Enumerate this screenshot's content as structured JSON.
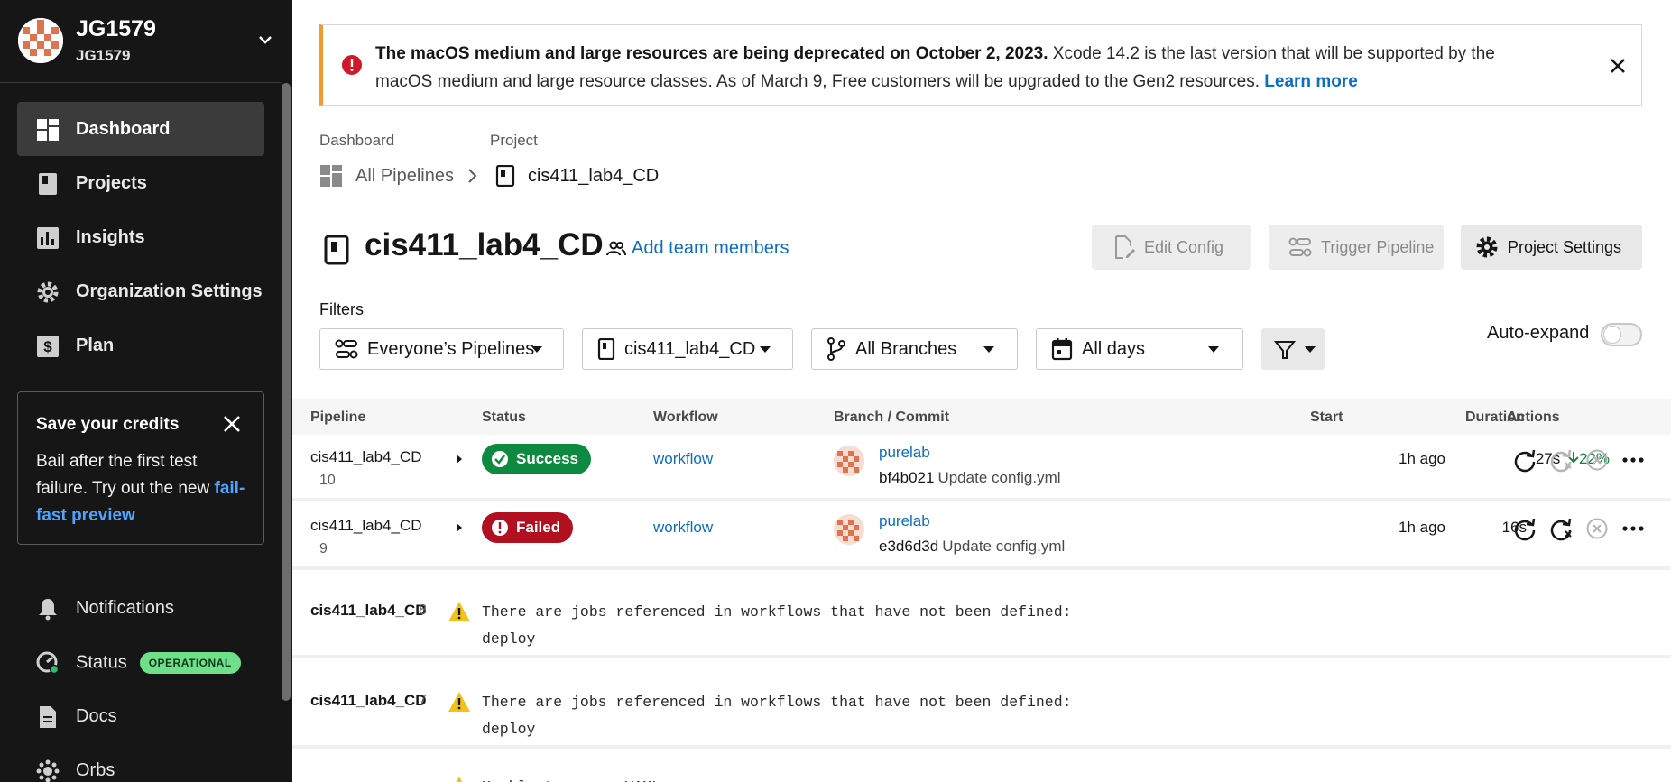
{
  "org": {
    "name": "JG1579",
    "sub": "JG1579"
  },
  "nav": [
    {
      "label": "Dashboard",
      "icon": "dashboard-icon",
      "active": true
    },
    {
      "label": "Projects",
      "icon": "projects-icon"
    },
    {
      "label": "Insights",
      "icon": "insights-icon"
    },
    {
      "label": "Organization Settings",
      "icon": "gear-icon"
    },
    {
      "label": "Plan",
      "icon": "plan-dollar-icon"
    }
  ],
  "credits": {
    "title": "Save your credits",
    "body": "Bail after the first test failure. Try out the new",
    "link": "fail-fast preview"
  },
  "bottom_nav": [
    {
      "label": "Notifications",
      "icon": "bell-icon"
    },
    {
      "label": "Status",
      "icon": "status-icon",
      "badge": "OPERATIONAL"
    },
    {
      "label": "Docs",
      "icon": "docs-icon"
    },
    {
      "label": "Orbs",
      "icon": "orbs-icon"
    }
  ],
  "banner": {
    "bold": "The macOS medium and large resources are being deprecated on October 2, 2023.",
    "text": " Xcode 14.2 is the last version that will be supported by the macOS medium and large resource classes. As of March 9, Free customers will be upgraded to the Gen2 resources. ",
    "link": "Learn more"
  },
  "breadcrumb": {
    "dashboard_label": "Dashboard",
    "project_label": "Project",
    "all_pipelines": "All Pipelines",
    "project": "cis411_lab4_CD"
  },
  "header": {
    "title": "cis411_lab4_CD",
    "add_team": "Add team members",
    "edit_config": "Edit Config",
    "trigger": "Trigger Pipeline",
    "settings": "Project Settings"
  },
  "filters": {
    "label": "Filters",
    "pipelines": "Everyone’s Pipelines",
    "project": "cis411_lab4_CD",
    "branches": "All Branches",
    "days": "All days",
    "auto_expand": "Auto-expand"
  },
  "table": {
    "headers": [
      "Pipeline",
      "Status",
      "Workflow",
      "Branch / Commit",
      "Start",
      "Duration",
      "Actions"
    ],
    "rows": [
      {
        "pipeline": "cis411_lab4_CD",
        "num": "10",
        "status": "Success",
        "workflow": "workflow",
        "author": "purelab",
        "sha": "bf4b021",
        "msg": "Update config.yml",
        "start": "1h ago",
        "duration": "27s",
        "pct": "22%"
      },
      {
        "pipeline": "cis411_lab4_CD",
        "num": "9",
        "status": "Failed",
        "workflow": "workflow",
        "author": "purelab",
        "sha": "e3d6d3d",
        "msg": "Update config.yml",
        "start": "1h ago",
        "duration": "16s",
        "pct": ""
      }
    ],
    "errors": [
      {
        "pipeline": "cis411_lab4_CD",
        "num": "8",
        "msg1": "There are jobs referenced in workflows that have not been defined:",
        "msg2": "deploy"
      },
      {
        "pipeline": "cis411_lab4_CD",
        "num": "7",
        "msg1": "There are jobs referenced in workflows that have not been defined:",
        "msg2": "deploy"
      },
      {
        "pipeline": "",
        "num": "",
        "msg1": "Unable to parse YAML",
        "msg2": ""
      }
    ]
  }
}
